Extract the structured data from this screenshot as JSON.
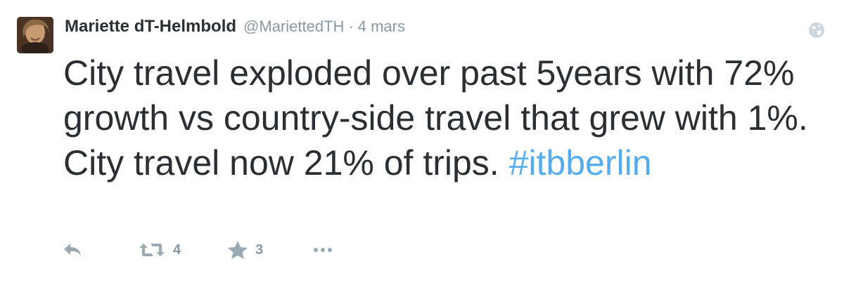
{
  "tweet": {
    "author_name": "Mariette dT-Helmbold",
    "author_handle": "@MariettedTH",
    "separator": "·",
    "timestamp": "4 mars",
    "text_main": "City travel exploded over past 5years with 72% growth vs country-side travel that grew with 1%. City travel now 21% of trips.",
    "hashtag": "#itbberlin",
    "retweet_count": "4",
    "favorite_count": "3"
  },
  "icons": {
    "avatar": "avatar-photo",
    "globe": "globe-icon",
    "reply": "reply-icon",
    "retweet": "retweet-icon",
    "favorite": "star-icon",
    "more": "more-dots-icon"
  },
  "colors": {
    "text": "#292f33",
    "muted": "#8899a6",
    "icon": "#99aab5",
    "hashtag": "#55acee"
  }
}
